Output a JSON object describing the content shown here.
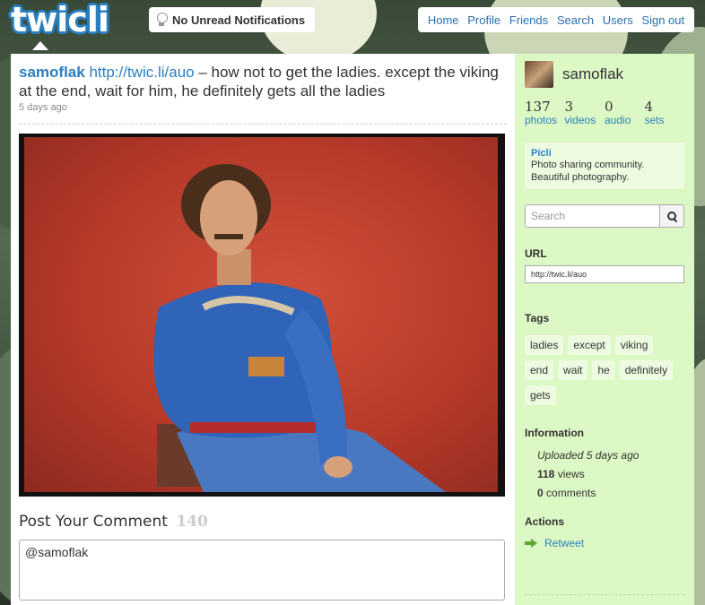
{
  "header": {
    "logo": "twicli",
    "notifications": "No Unread Notifications",
    "nav": [
      "Home",
      "Profile",
      "Friends",
      "Search",
      "Users",
      "Sign out"
    ]
  },
  "post": {
    "username": "samoflak",
    "link": "http://twic.li/auo",
    "text": " – how not to get the ladies. except the viking at the end, wait for him, he definitely gets all the ladies",
    "time": "5 days ago"
  },
  "comment": {
    "title": "Post Your Comment",
    "remaining": "140",
    "value": "@samoflak"
  },
  "sidebar": {
    "username": "samoflak",
    "stats": [
      {
        "num": "137",
        "label": "photos"
      },
      {
        "num": "3",
        "label": "videos"
      },
      {
        "num": "0",
        "label": "audio"
      },
      {
        "num": "4",
        "label": "sets"
      }
    ],
    "picli": {
      "title": "Picli",
      "desc": "Photo sharing community. Beautiful photography."
    },
    "search_placeholder": "Search",
    "url_heading": "URL",
    "url_value": "http://twic.li/auo",
    "tags_heading": "Tags",
    "tags": [
      "ladies",
      "except",
      "viking",
      "end",
      "wait",
      "he",
      "definitely",
      "gets"
    ],
    "info_heading": "Information",
    "info": {
      "uploaded": "Uploaded 5 days ago",
      "views_num": "118",
      "views_label": " views",
      "comments_num": "0",
      "comments_label": " comments"
    },
    "actions_heading": "Actions",
    "retweet": "Retweet"
  },
  "colors": {
    "accent": "#2a7fc0",
    "sidebar_bg": "#dcf8c4",
    "retweet_arrow": "#5ca832"
  }
}
